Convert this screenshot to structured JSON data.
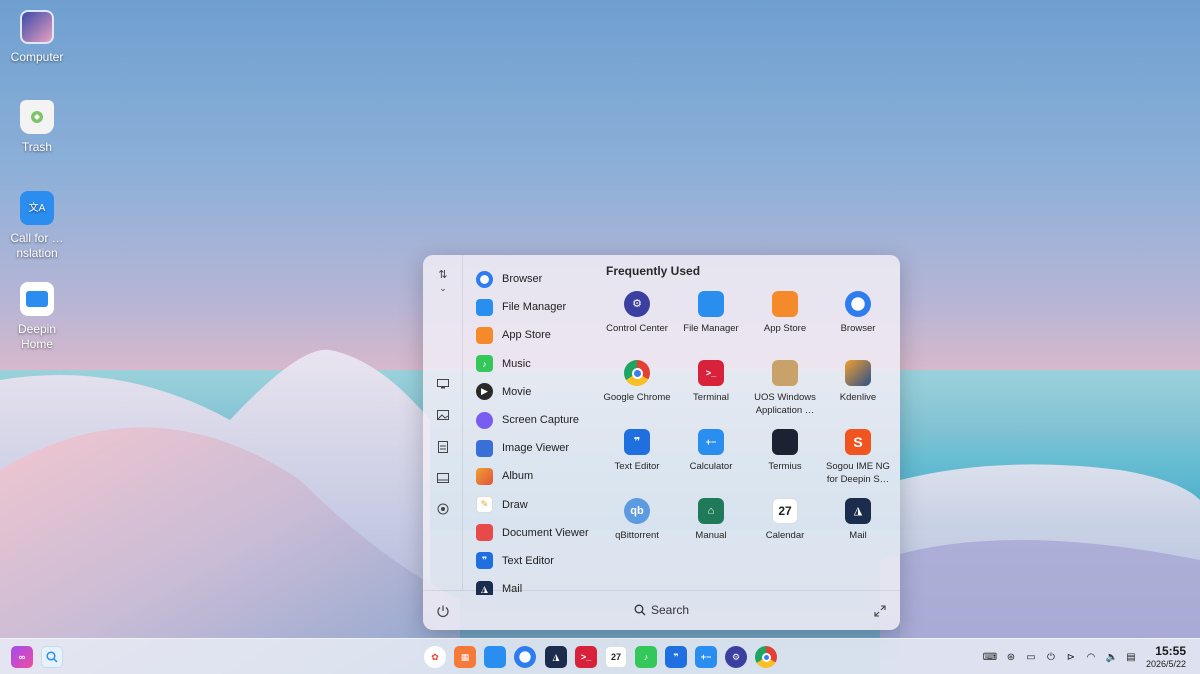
{
  "desktop": {
    "icons": [
      {
        "label": "Computer",
        "icon": "computer-icon"
      },
      {
        "label": "Trash",
        "icon": "trash-icon"
      },
      {
        "label": "Call for …nslation",
        "icon": "translate-icon"
      },
      {
        "label": "Deepin Home",
        "icon": "deepin-home-icon"
      }
    ]
  },
  "launcher": {
    "app_list": [
      {
        "label": "Browser",
        "icon": "browser-icon",
        "color": "#2f7cf0"
      },
      {
        "label": "File Manager",
        "icon": "file-manager-icon",
        "color": "#2a8ef0"
      },
      {
        "label": "App Store",
        "icon": "app-store-icon",
        "color": "#f58a2a"
      },
      {
        "label": "Music",
        "icon": "music-icon",
        "color": "#34c759"
      },
      {
        "label": "Movie",
        "icon": "movie-icon",
        "color": "#2a2a2a"
      },
      {
        "label": "Screen Capture",
        "icon": "screen-capture-icon",
        "color": "#7a5cf0"
      },
      {
        "label": "Image Viewer",
        "icon": "image-viewer-icon",
        "color": "#3a6fd8"
      },
      {
        "label": "Album",
        "icon": "album-icon",
        "color": "#e0533a"
      },
      {
        "label": "Draw",
        "icon": "draw-icon",
        "color": "#f0a030"
      },
      {
        "label": "Document Viewer",
        "icon": "document-viewer-icon",
        "color": "#e84a4a"
      },
      {
        "label": "Text Editor",
        "icon": "text-editor-icon",
        "color": "#1f6fe0"
      },
      {
        "label": "Mail",
        "icon": "mail-icon",
        "color": "#1c2c4c"
      }
    ],
    "frequently_used_title": "Frequently Used",
    "frequent": [
      {
        "label": "Control Center",
        "icon": "control-center-icon",
        "color": "#3b3fa0"
      },
      {
        "label": "File Manager",
        "icon": "file-manager-icon",
        "color": "#2a8ef0"
      },
      {
        "label": "App Store",
        "icon": "app-store-icon",
        "color": "#f58a2a"
      },
      {
        "label": "Browser",
        "icon": "browser-icon",
        "color": "#2f7cf0"
      },
      {
        "label": "Google Chrome",
        "icon": "chrome-icon",
        "color": "#e34133"
      },
      {
        "label": "Terminal",
        "icon": "terminal-icon",
        "color": "#d8213a"
      },
      {
        "label": "UOS Windows Application …",
        "icon": "uos-windows-icon",
        "color": "#c9a26a"
      },
      {
        "label": "Kdenlive",
        "icon": "kdenlive-icon",
        "color": "#2b4f8a"
      },
      {
        "label": "Text Editor",
        "icon": "text-editor-icon",
        "color": "#1f6fe0"
      },
      {
        "label": "Calculator",
        "icon": "calculator-icon",
        "color": "#2a8ef0"
      },
      {
        "label": "Termius",
        "icon": "termius-icon",
        "color": "#1b2232"
      },
      {
        "label": "Sogou IME NG for Deepin S…",
        "icon": "sogou-icon",
        "color": "#f0551f"
      },
      {
        "label": "qBittorrent",
        "icon": "qbittorrent-icon",
        "color": "#5c9be0"
      },
      {
        "label": "Manual",
        "icon": "manual-icon",
        "color": "#1f7a5a"
      },
      {
        "label": "Calendar",
        "icon": "calendar-icon",
        "color": "#ffffff"
      },
      {
        "label": "Mail",
        "icon": "mail-icon",
        "color": "#1c2c4c"
      }
    ],
    "calendar_day": "27",
    "search_label": "Search"
  },
  "taskbar": {
    "clock_time": "15:55",
    "clock_date": "2026/5/22",
    "calendar_day": "27"
  }
}
